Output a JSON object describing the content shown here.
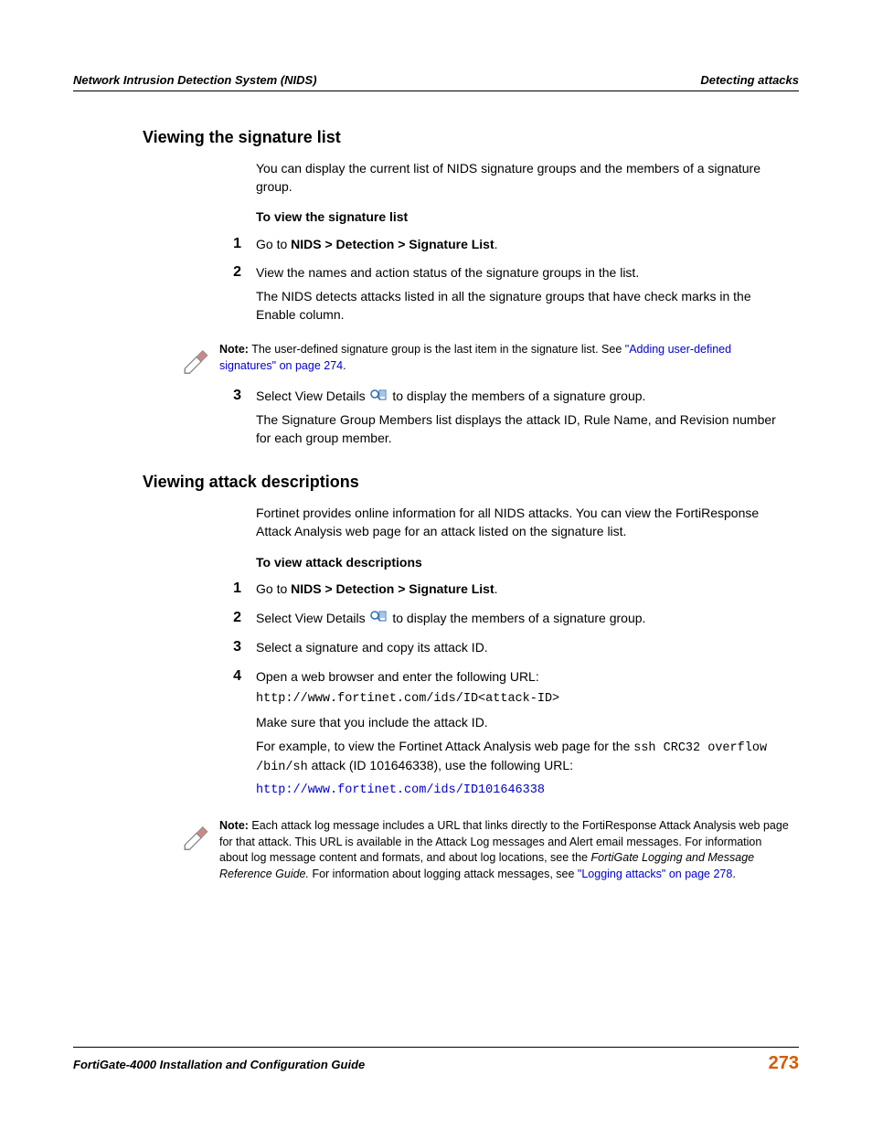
{
  "header": {
    "left": "Network Intrusion Detection System (NIDS)",
    "right": "Detecting attacks"
  },
  "section1": {
    "heading": "Viewing the signature list",
    "intro": "You can display the current list of NIDS signature groups and the members of a signature group.",
    "sub": "To view the signature list",
    "step1_num": "1",
    "step1_a": "Go to ",
    "step1_b": "NIDS > Detection > Signature List",
    "step1_c": ".",
    "step2_num": "2",
    "step2_a": "View the names and action status of the signature groups in the list.",
    "step2_b": "The NIDS detects attacks listed in all the signature groups that have check marks in the Enable column.",
    "note_a": "Note:",
    "note_b": " The user-defined signature group is the last item in the signature list. See ",
    "note_c": "\"Adding user-defined signatures\" on page 274",
    "note_d": ".",
    "step3_num": "3",
    "step3_a": "Select View Details ",
    "step3_b": " to display the members of a signature group.",
    "step3_c": "The Signature Group Members list displays the attack ID, Rule Name, and Revision number for each group member."
  },
  "section2": {
    "heading": "Viewing attack descriptions",
    "intro": "Fortinet provides online information for all NIDS attacks. You can view the FortiResponse Attack Analysis web page for an attack listed on the signature list.",
    "sub": "To view attack descriptions",
    "step1_num": "1",
    "step1_a": "Go to ",
    "step1_b": "NIDS > Detection > Signature List",
    "step1_c": ".",
    "step2_num": "2",
    "step2_a": "Select View Details ",
    "step2_b": " to display the members of a signature group.",
    "step3_num": "3",
    "step3_a": "Select a signature and copy its attack ID.",
    "step4_num": "4",
    "step4_a": "Open a web browser and enter the following URL:",
    "step4_b": "http://www.fortinet.com/ids/ID<attack-ID>",
    "step4_c": "Make sure that you include the attack ID.",
    "step4_d": "For example, to view the Fortinet Attack Analysis web page for the ",
    "step4_e": "ssh CRC32 overflow /bin/sh",
    "step4_f": " attack (ID 101646338), use the following URL:",
    "step4_g": "http://www.fortinet.com/ids/ID101646338",
    "note_a": "Note:",
    "note_b": " Each attack log message includes a URL that links directly to the FortiResponse Attack Analysis web page for that attack. This URL is available in the Attack Log messages and Alert email messages. For information about log message content and formats, and about log locations, see the ",
    "note_c": "FortiGate Logging and Message Reference Guide.",
    "note_d": " For information about logging attack messages, see ",
    "note_e": "\"Logging attacks\" on page 278",
    "note_f": "."
  },
  "footer": {
    "left": "FortiGate-4000 Installation and Configuration Guide",
    "right": "273"
  }
}
